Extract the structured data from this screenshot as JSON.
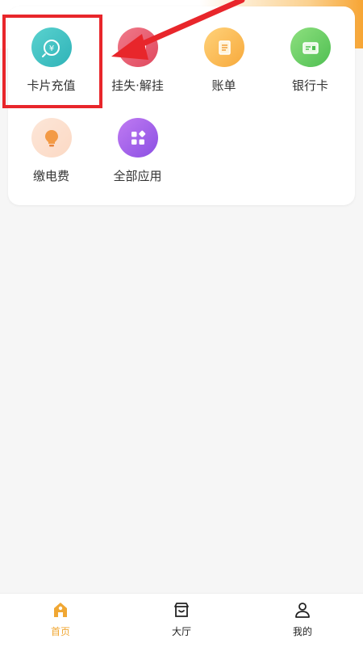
{
  "services": [
    {
      "label": "卡片充值",
      "icon": "yuan-recharge-icon",
      "color_from": "#5ad2cf",
      "color_to": "#2fb3b8"
    },
    {
      "label": "挂失·解挂",
      "icon": "card-lock-icon",
      "color_from": "#f07a8a",
      "color_to": "#e0485e"
    },
    {
      "label": "账单",
      "icon": "bill-document-icon",
      "color_from": "#ffd27a",
      "color_to": "#f7a93b"
    },
    {
      "label": "银行卡",
      "icon": "bank-card-icon",
      "color_from": "#8ee07f",
      "color_to": "#4fbf52"
    },
    {
      "label": "缴电费",
      "icon": "lightbulb-icon",
      "color_from": "#fde6d8",
      "color_to": "#fbd9c4"
    },
    {
      "label": "全部应用",
      "icon": "all-apps-grid-icon",
      "color_from": "#c07bf2",
      "color_to": "#8b4fe3"
    }
  ],
  "bottom_nav": [
    {
      "label": "首页",
      "icon": "home-icon",
      "active": true
    },
    {
      "label": "大厅",
      "icon": "shop-hall-icon",
      "active": false
    },
    {
      "label": "我的",
      "icon": "user-profile-icon",
      "active": false
    }
  ],
  "colors": {
    "accent": "#f0a733",
    "annotation": "#e8262b"
  }
}
